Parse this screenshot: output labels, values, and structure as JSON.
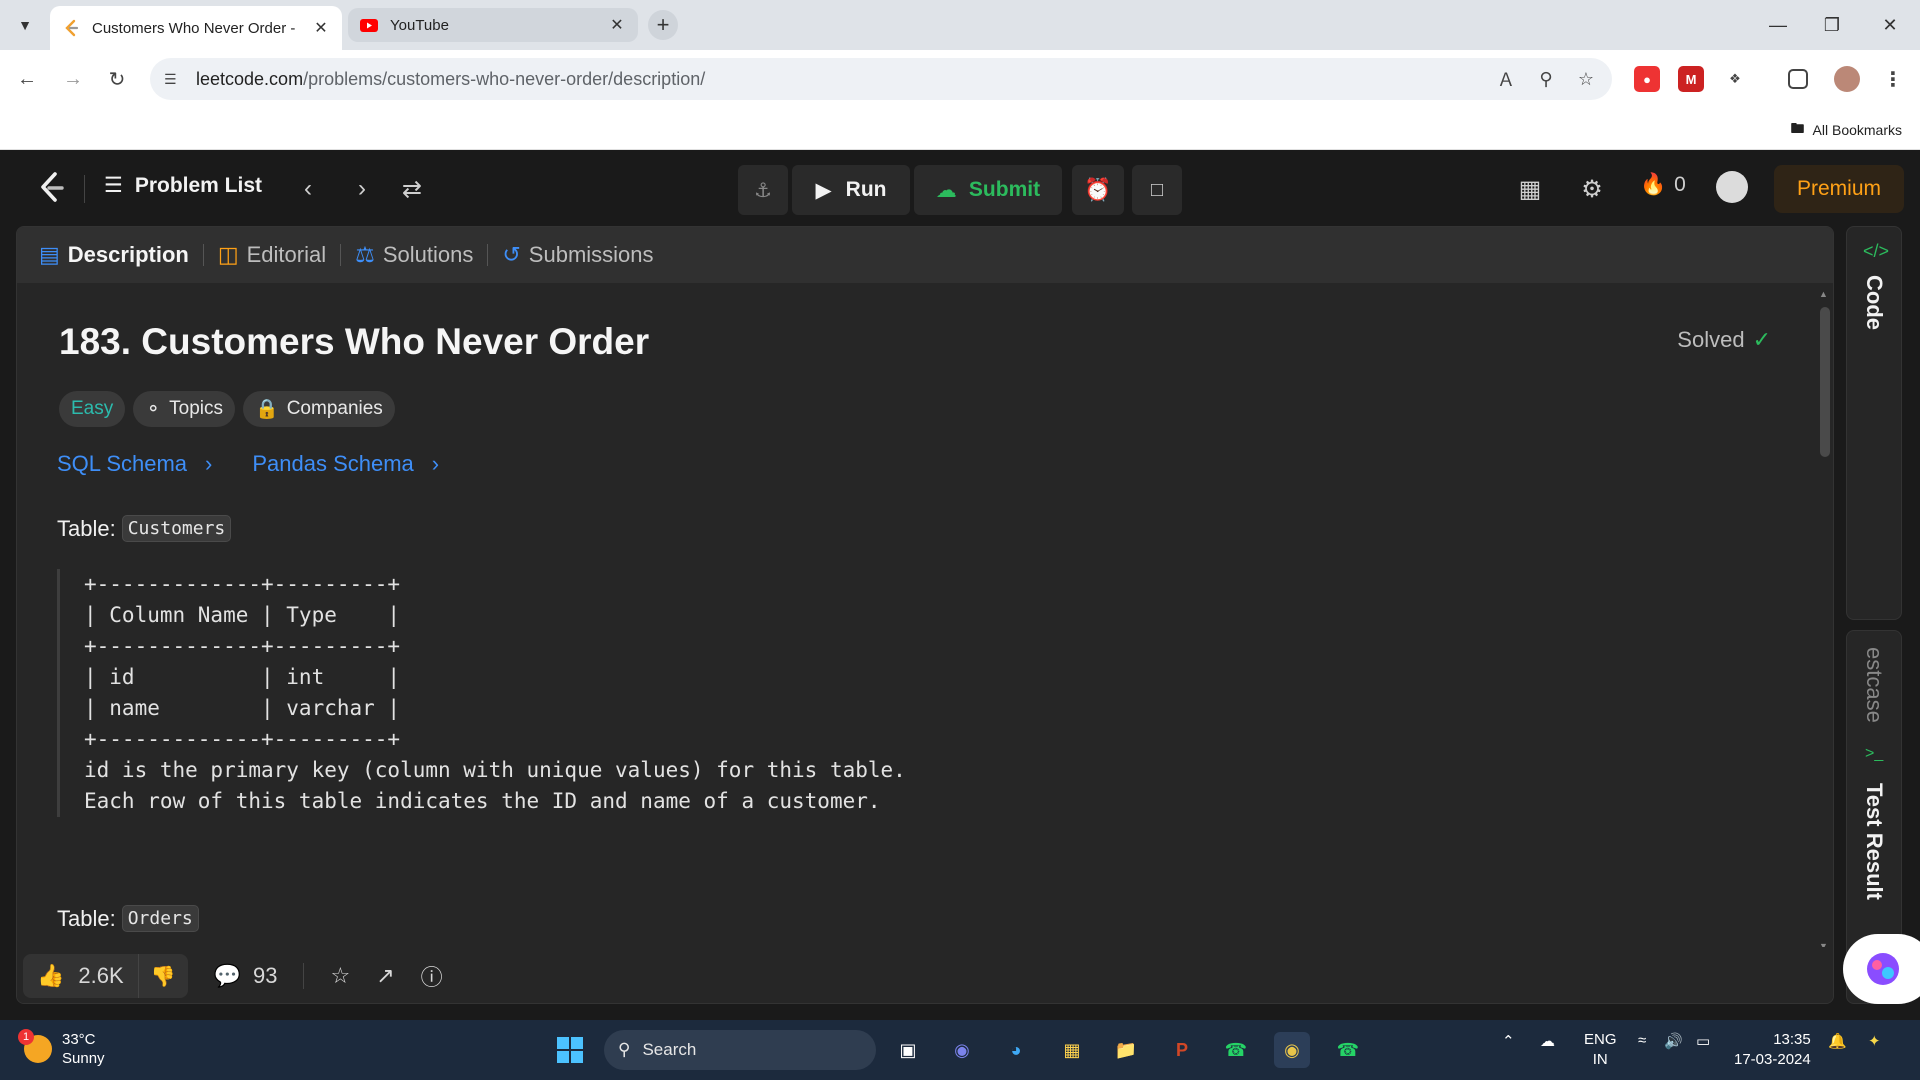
{
  "browser": {
    "tabs": [
      {
        "title": "Customers Who Never Order - ",
        "active": true
      },
      {
        "title": "YouTube",
        "active": false
      }
    ],
    "url_host": "leetcode.com",
    "url_path": "/problems/customers-who-never-order/description/",
    "bookmarks_label": "All Bookmarks"
  },
  "lc_header": {
    "problem_list": "Problem List",
    "run": "Run",
    "submit": "Submit",
    "streak": "0",
    "premium": "Premium"
  },
  "panel_tabs": [
    "Description",
    "Editorial",
    "Solutions",
    "Submissions"
  ],
  "problem": {
    "title": "183. Customers Who Never Order",
    "status": "Solved",
    "difficulty": "Easy",
    "topics": "Topics",
    "companies": "Companies",
    "links": [
      "SQL Schema",
      "Pandas Schema"
    ],
    "table_label": "Table:",
    "table1_name": "Customers",
    "table1_block": "+-------------+---------+\n| Column Name | Type    |\n+-------------+---------+\n| id          | int     |\n| name        | varchar |\n+-------------+---------+\nid is the primary key (column with unique values) for this table.\nEach row of this table indicates the ID and name of a customer.",
    "table2_name": "Orders"
  },
  "footer": {
    "likes": "2.6K",
    "comments": "93"
  },
  "side_panels": {
    "code": "Code",
    "testcase": "estcase",
    "test_result": "Test Result"
  },
  "taskbar": {
    "weather_temp": "33°C",
    "weather_desc": "Sunny",
    "weather_badge": "1",
    "search": "Search",
    "lang1": "ENG",
    "lang2": "IN",
    "time": "13:35",
    "date": "17-03-2024"
  },
  "colors": {
    "accent_green": "#2cbb5d",
    "easy": "#2cbbad",
    "link_blue": "#3e8ef7",
    "premium": "#ffa116"
  }
}
